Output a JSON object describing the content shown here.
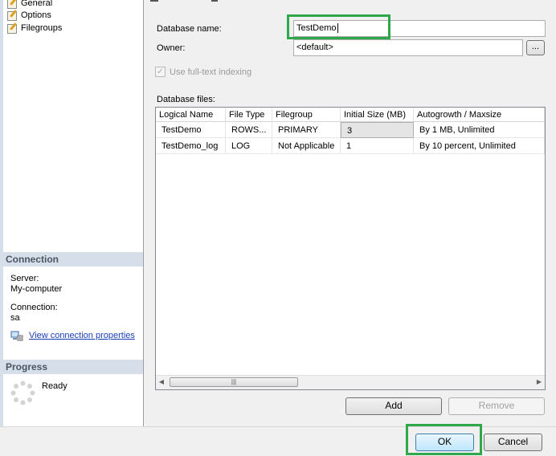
{
  "pages": {
    "items": [
      {
        "label": "General",
        "icon": "page-icon"
      },
      {
        "label": "Options",
        "icon": "page-icon"
      },
      {
        "label": "Filegroups",
        "icon": "page-icon"
      }
    ]
  },
  "connection": {
    "header": "Connection",
    "server_label": "Server:",
    "server_value": "My-computer",
    "connection_label": "Connection:",
    "connection_value": "sa",
    "link_text": "View connection properties",
    "link_icon": "connection-properties-icon"
  },
  "progress": {
    "header": "Progress",
    "status": "Ready",
    "icon": "spinner-icon"
  },
  "form": {
    "db_name_label": "Database name:",
    "db_name_value": "TestDemo",
    "owner_label": "Owner:",
    "owner_value": "<default>",
    "browse_label": "...",
    "fulltext_label": "Use full-text indexing",
    "fulltext_checked": true,
    "fulltext_enabled": false
  },
  "files": {
    "label": "Database files:",
    "columns": [
      "Logical Name",
      "File Type",
      "Filegroup",
      "Initial Size (MB)",
      "Autogrowth / Maxsize"
    ],
    "rows": [
      [
        "TestDemo",
        "ROWS...",
        "PRIMARY",
        "3",
        "By 1 MB, Unlimited"
      ],
      [
        "TestDemo_log",
        "LOG",
        "Not Applicable",
        "1",
        "By 10 percent, Unlimited"
      ]
    ],
    "scroll_thumb_grip": "|||"
  },
  "buttons": {
    "add": "Add",
    "remove": "Remove",
    "ok": "OK",
    "cancel": "Cancel"
  },
  "colors": {
    "highlight": "#2ea84a",
    "section_header_bg": "#d6dfe9",
    "link": "#1a3fb6"
  }
}
